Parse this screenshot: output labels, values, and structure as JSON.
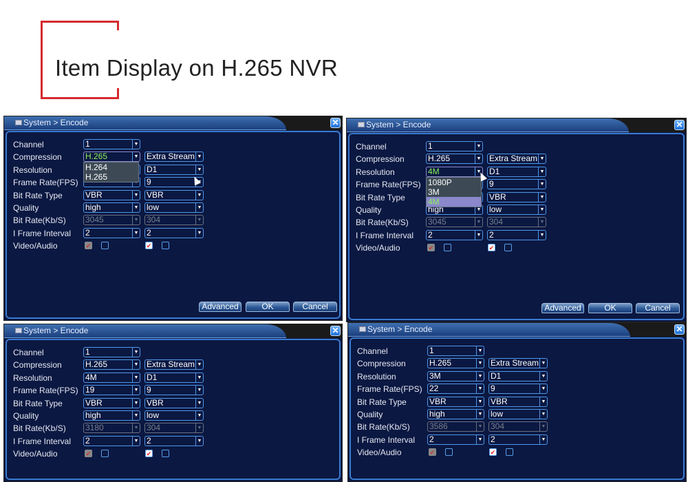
{
  "heading": "Item Display on H.265 NVR",
  "accent_color": "#d42a2f",
  "labels": [
    "Channel",
    "Compression",
    "Resolution",
    "Frame Rate(FPS)",
    "Bit Rate Type",
    "Quality",
    "Bit Rate(Kb/S)",
    "I Frame Interval",
    "Video/Audio"
  ],
  "buttons": {
    "advanced": "Advanced",
    "ok": "OK",
    "cancel": "Cancel"
  },
  "panels": [
    {
      "title": "System > Encode",
      "close_icon": "close-icon",
      "channel": "1",
      "main": {
        "compression": "H.265",
        "resolution": "",
        "frame_rate": "",
        "bit_rate_type": "VBR",
        "quality": "high",
        "bit_rate": "3045",
        "i_frame": "2"
      },
      "extra": {
        "stream": "Extra Stream",
        "resolution": "D1",
        "frame_rate": "9",
        "bit_rate_type": "VBR",
        "quality": "low",
        "bit_rate": "304",
        "i_frame": "2"
      },
      "video_main": true,
      "audio_main": false,
      "video_extra": true,
      "audio_extra": false,
      "dropdown": {
        "field": "compression",
        "options": [
          "H.264",
          "H.265"
        ],
        "selected": ""
      },
      "show_buttons": true
    },
    {
      "title": "System > Encode",
      "close_icon": "close-icon",
      "channel": "1",
      "main": {
        "compression": "H.265",
        "resolution": "4M",
        "frame_rate": "",
        "bit_rate_type": "",
        "quality": "high",
        "bit_rate": "3045",
        "i_frame": "2"
      },
      "extra": {
        "stream": "Extra Stream",
        "resolution": "D1",
        "frame_rate": "9",
        "bit_rate_type": "VBR",
        "quality": "low",
        "bit_rate": "304",
        "i_frame": "2"
      },
      "video_main": true,
      "audio_main": false,
      "video_extra": true,
      "audio_extra": false,
      "dropdown": {
        "field": "resolution",
        "options": [
          "1080P",
          "3M",
          "4M"
        ],
        "selected": "4M"
      },
      "show_buttons": true
    },
    {
      "title": "System > Encode",
      "close_icon": "close-icon",
      "channel": "1",
      "main": {
        "compression": "H.265",
        "resolution": "4M",
        "frame_rate": "19",
        "bit_rate_type": "VBR",
        "quality": "high",
        "bit_rate": "3180",
        "i_frame": "2"
      },
      "extra": {
        "stream": "Extra Stream",
        "resolution": "D1",
        "frame_rate": "9",
        "bit_rate_type": "VBR",
        "quality": "low",
        "bit_rate": "304",
        "i_frame": "2"
      },
      "video_main": true,
      "audio_main": false,
      "video_extra": true,
      "audio_extra": false,
      "show_buttons": false
    },
    {
      "title": "System > Encode",
      "close_icon": "close-icon",
      "channel": "1",
      "main": {
        "compression": "H.265",
        "resolution": "3M",
        "frame_rate": "22",
        "bit_rate_type": "VBR",
        "quality": "high",
        "bit_rate": "3586",
        "i_frame": "2"
      },
      "extra": {
        "stream": "Extra Stream",
        "resolution": "D1",
        "frame_rate": "9",
        "bit_rate_type": "VBR",
        "quality": "low",
        "bit_rate": "304",
        "i_frame": "2"
      },
      "video_main": true,
      "audio_main": false,
      "video_extra": true,
      "audio_extra": false,
      "show_buttons": false
    }
  ]
}
